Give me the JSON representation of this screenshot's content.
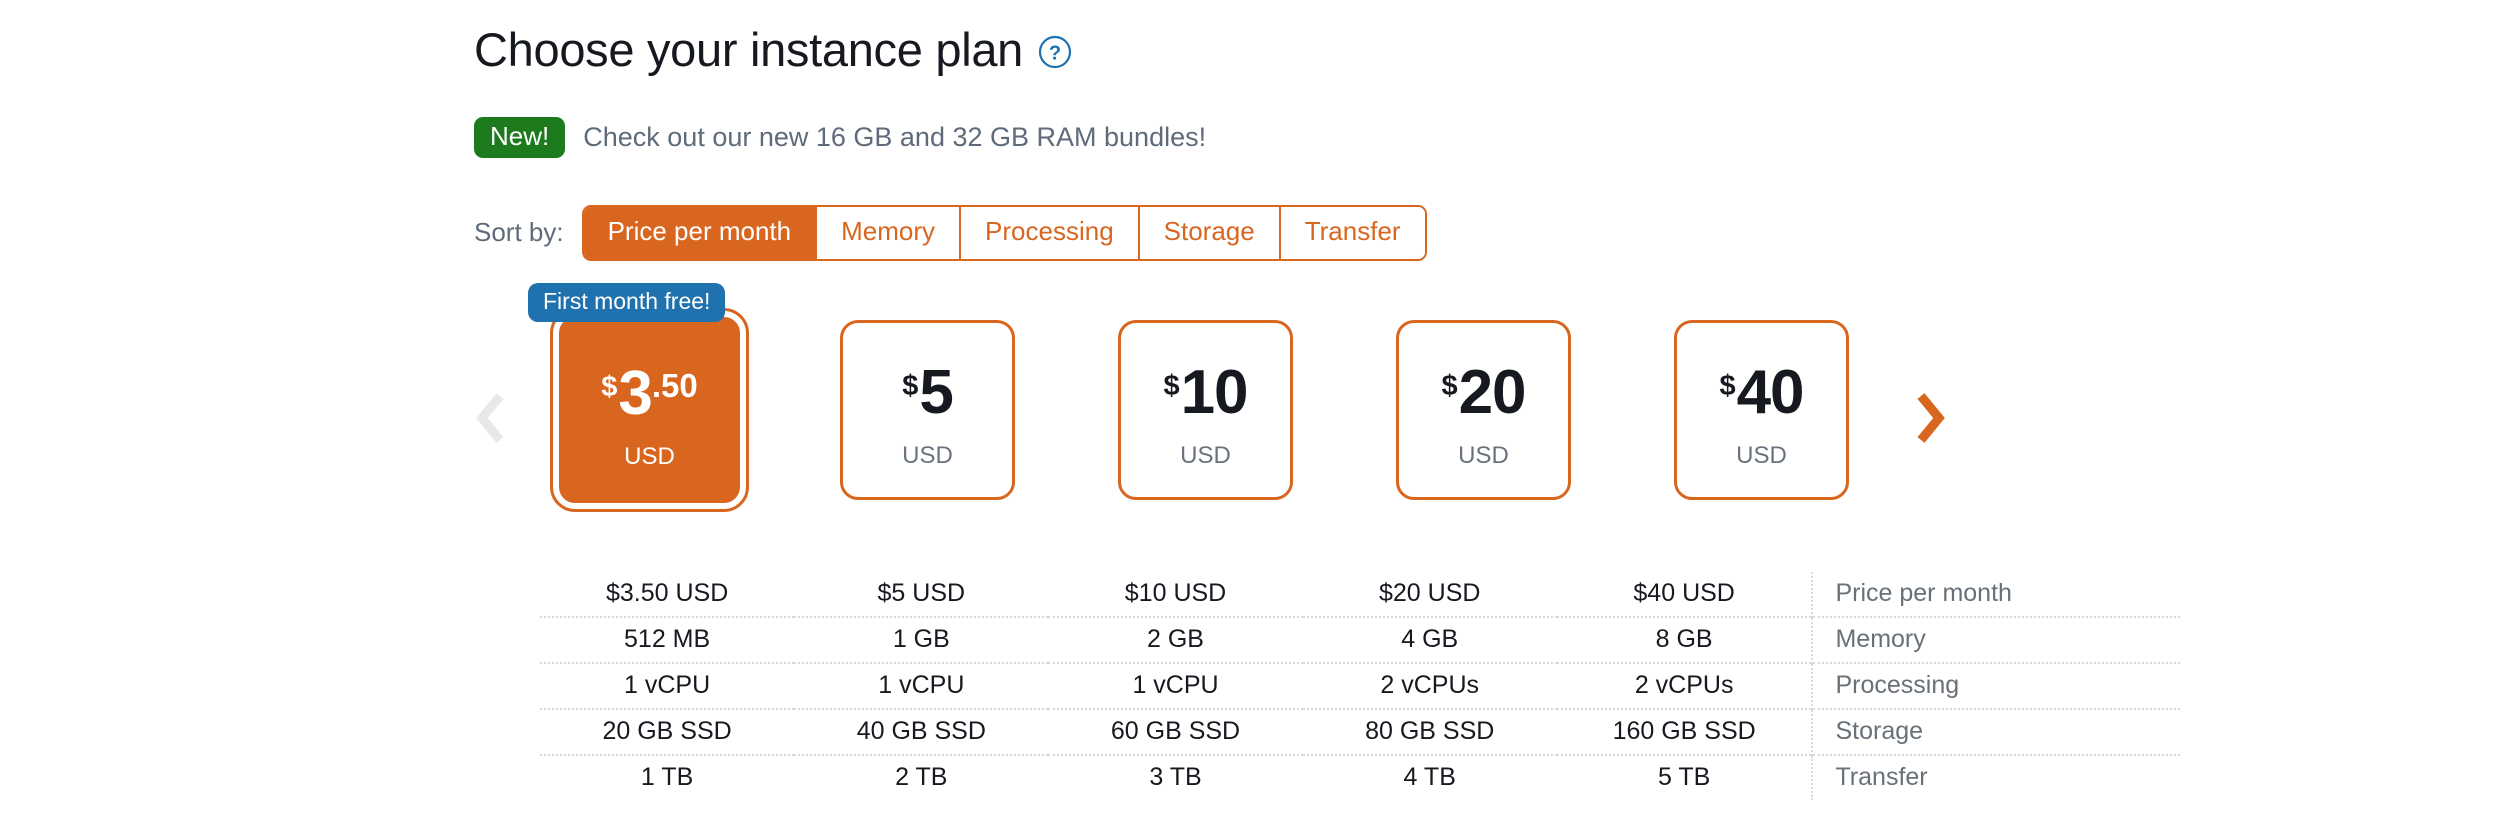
{
  "header": {
    "title": "Choose your instance plan",
    "help_icon": "question-circle-icon",
    "new_badge": "New!",
    "new_message": "Check out our new 16 GB and 32 GB RAM bundles!"
  },
  "sort": {
    "label": "Sort by:",
    "tabs": [
      {
        "label": "Price per month",
        "active": true
      },
      {
        "label": "Memory",
        "active": false
      },
      {
        "label": "Processing",
        "active": false
      },
      {
        "label": "Storage",
        "active": false
      },
      {
        "label": "Transfer",
        "active": false
      }
    ]
  },
  "carousel": {
    "prev_icon": "chevron-left-icon",
    "next_icon": "chevron-right-icon",
    "prev_enabled": false,
    "next_enabled": true,
    "promo_badge": "First month free!",
    "currency_symbol": "$",
    "currency_label": "USD",
    "cards": [
      {
        "amount": "3",
        "cents": ".50",
        "currency": "$",
        "unit": "USD",
        "selected": true
      },
      {
        "amount": "5",
        "cents": "",
        "currency": "$",
        "unit": "USD",
        "selected": false
      },
      {
        "amount": "10",
        "cents": "",
        "currency": "$",
        "unit": "USD",
        "selected": false
      },
      {
        "amount": "20",
        "cents": "",
        "currency": "$",
        "unit": "USD",
        "selected": false
      },
      {
        "amount": "40",
        "cents": "",
        "currency": "$",
        "unit": "USD",
        "selected": false
      }
    ]
  },
  "spec_table": {
    "row_labels": [
      "Price per month",
      "Memory",
      "Processing",
      "Storage",
      "Transfer"
    ],
    "columns": [
      {
        "price": "$3.50 USD",
        "memory": "512 MB",
        "processing": "1 vCPU",
        "storage": "20 GB SSD",
        "transfer": "1 TB"
      },
      {
        "price": "$5 USD",
        "memory": "1 GB",
        "processing": "1 vCPU",
        "storage": "40 GB SSD",
        "transfer": "2 TB"
      },
      {
        "price": "$10 USD",
        "memory": "2 GB",
        "processing": "1 vCPU",
        "storage": "60 GB SSD",
        "transfer": "3 TB"
      },
      {
        "price": "$20 USD",
        "memory": "4 GB",
        "processing": "2 vCPUs",
        "storage": "80 GB SSD",
        "transfer": "4 TB"
      },
      {
        "price": "$40 USD",
        "memory": "8 GB",
        "processing": "2 vCPUs",
        "storage": "160 GB SSD",
        "transfer": "5 TB"
      }
    ],
    "rows": [
      {
        "label": "Price per month",
        "values": [
          "$3.50 USD",
          "$5 USD",
          "$10 USD",
          "$20 USD",
          "$40 USD"
        ]
      },
      {
        "label": "Memory",
        "values": [
          "512 MB",
          "1 GB",
          "2 GB",
          "4 GB",
          "8 GB"
        ]
      },
      {
        "label": "Processing",
        "values": [
          "1 vCPU",
          "1 vCPU",
          "1 vCPU",
          "2 vCPUs",
          "2 vCPUs"
        ]
      },
      {
        "label": "Storage",
        "values": [
          "20 GB SSD",
          "40 GB SSD",
          "60 GB SSD",
          "80 GB SSD",
          "160 GB SSD"
        ]
      },
      {
        "label": "Transfer",
        "values": [
          "1 TB",
          "2 TB",
          "3 TB",
          "4 TB",
          "5 TB"
        ]
      }
    ]
  },
  "colors": {
    "accent_orange": "#d9661f",
    "badge_blue": "#1f72ad",
    "badge_green": "#1d7a1d",
    "help_blue": "#1f72ad",
    "text_dark": "#16191f",
    "text_muted": "#68737d",
    "divider": "#d5dbdb",
    "chevron_disabled": "#e6e8ea"
  }
}
